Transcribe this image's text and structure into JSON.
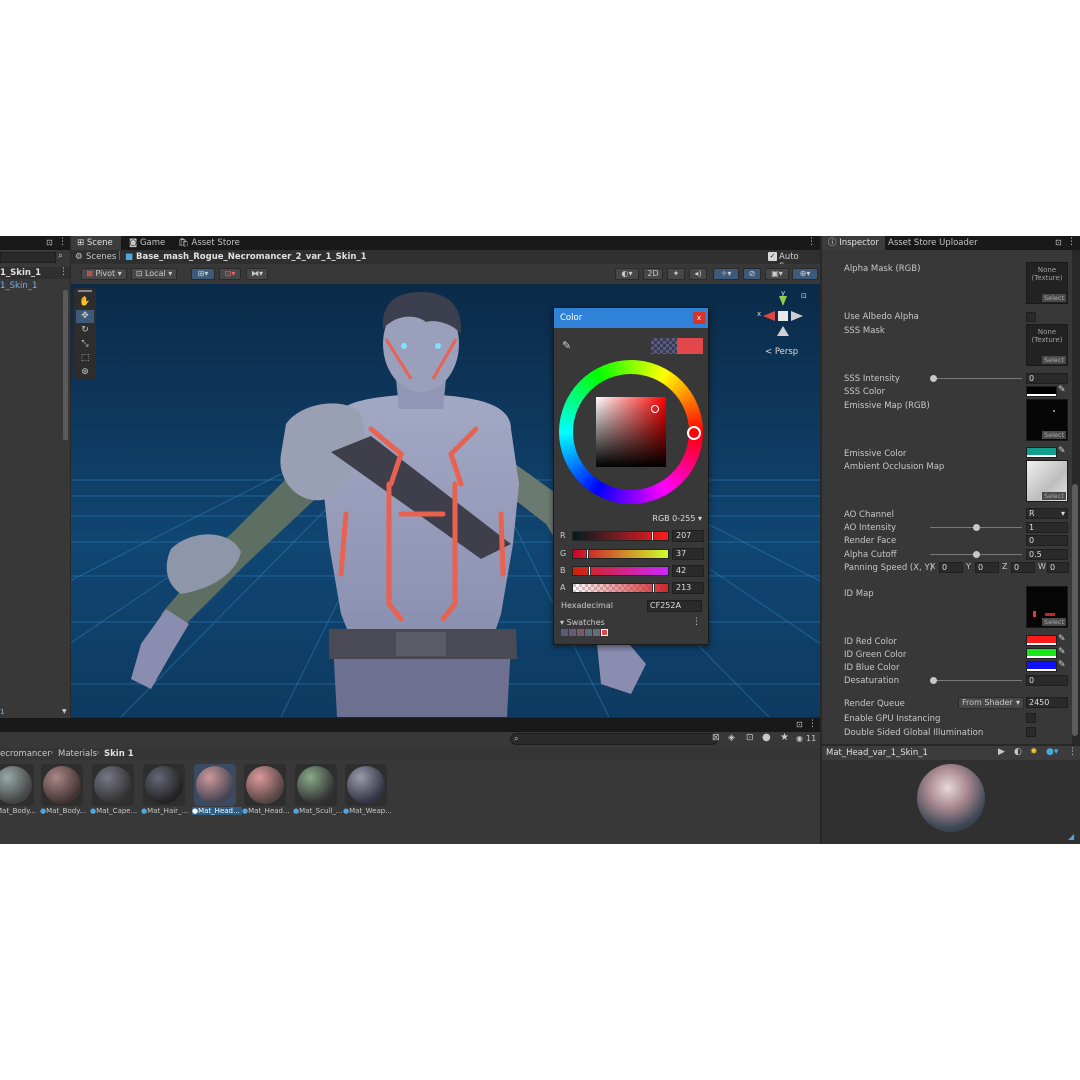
{
  "hierarchy": {
    "items": [
      "1_Skin_1",
      "1_Skin_1"
    ]
  },
  "scene_tabs": [
    {
      "label": "Scene",
      "icon": "scene-grid-icon"
    },
    {
      "label": "Game",
      "icon": "gamepad-icon"
    },
    {
      "label": "Asset Store",
      "icon": "store-bag-icon"
    }
  ],
  "breadcrumb": {
    "root": "Scenes",
    "object": "Base_mash_Rogue_Necromancer_2_var_1_Skin_1",
    "auto_save": "Auto Save"
  },
  "scene_toolbar": {
    "pivot": "Pivot",
    "local": "Local",
    "mode_2d": "2D",
    "persp": "< Persp"
  },
  "gizmo": {
    "x": "x",
    "y": "y"
  },
  "color_picker": {
    "title": "Color",
    "close": "x",
    "mode": "RGB 0-255",
    "channels": [
      {
        "label": "R",
        "value": "207"
      },
      {
        "label": "G",
        "value": "37"
      },
      {
        "label": "B",
        "value": "42"
      },
      {
        "label": "A",
        "value": "213"
      }
    ],
    "hex_label": "Hexadecimal",
    "hex_value": "CF252A",
    "swatches_label": "Swatches",
    "color": "#cf252a"
  },
  "inspector": {
    "tabs": [
      "Inspector",
      "Asset Store Uploader"
    ],
    "none_texture": "None\n(Texture)",
    "select": "Select",
    "alpha_mask": "Alpha Mask (RGB)",
    "use_albedo_alpha": "Use Albedo Alpha",
    "sss_mask": "SSS Mask",
    "sss_intensity": "SSS Intensity",
    "sss_intensity_value": "0",
    "sss_color": "SSS Color",
    "emissive_map": "Emissive Map (RGB)",
    "emissive_color": "Emissive Color",
    "emissive_color_hex": "#119e8c",
    "ao_map": "Ambient Occlusion Map",
    "ao_channel": "AO Channel",
    "ao_channel_value": "R",
    "ao_intensity": "AO Intensity",
    "ao_intensity_value": "1",
    "render_face": "Render Face",
    "render_face_value": "0",
    "alpha_cutoff": "Alpha Cutoff",
    "alpha_cutoff_value": "0.5",
    "panning_speed": "Panning Speed (X, Y)",
    "panning": [
      {
        "axis": "X",
        "value": "0"
      },
      {
        "axis": "Y",
        "value": "0"
      },
      {
        "axis": "Z",
        "value": "0"
      },
      {
        "axis": "W",
        "value": "0"
      }
    ],
    "id_map": "ID Map",
    "id_red_color": "ID Red Color",
    "id_green_color": "ID Green Color",
    "id_blue_color": "ID Blue Color",
    "desaturation": "Desaturation",
    "desaturation_value": "0",
    "render_queue": "Render Queue",
    "render_queue_source": "From Shader",
    "render_queue_value": "2450",
    "gpu_instancing": "Enable GPU Instancing",
    "double_sided_gi": "Double Sided Global Illumination"
  },
  "project": {
    "breadcrumb": [
      "ecromancer",
      "Materials",
      "Skin 1"
    ],
    "count": "11",
    "materials": [
      {
        "label": "Mat_Body..."
      },
      {
        "label": "Mat_Body..."
      },
      {
        "label": "Mat_Cape..."
      },
      {
        "label": "Mat_Hair_..."
      },
      {
        "label": "Mat_Head..."
      },
      {
        "label": "Mat_Head..."
      },
      {
        "label": "Mat_Scull_..."
      },
      {
        "label": "Mat_Weap..."
      }
    ]
  },
  "preview": {
    "title": "Mat_Head_var_1_Skin_1"
  }
}
